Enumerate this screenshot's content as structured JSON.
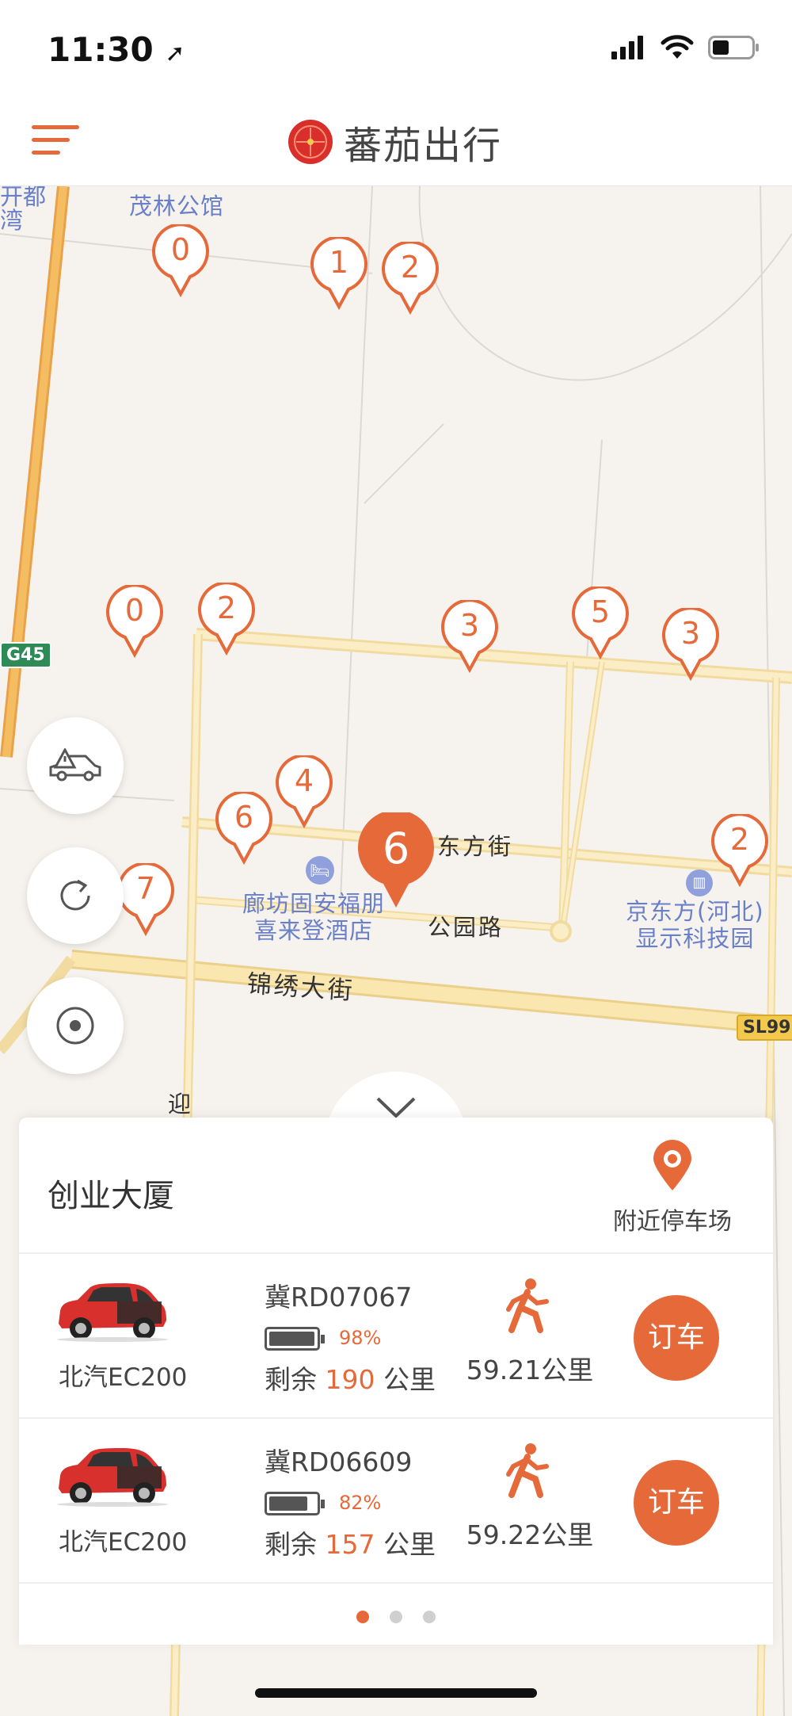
{
  "status_bar": {
    "time": "11:30"
  },
  "header": {
    "title": "蕃茄出行"
  },
  "map": {
    "labels": {
      "top_poi": "茂林公馆",
      "left_edge_top": "开都",
      "left_edge_bottom": "湾",
      "dongfang_street": "东方街",
      "park_road": "公园路",
      "jinxiu_street": "锦绣大街",
      "ying": "迎",
      "hotel_line1": "廊坊固安福朋",
      "hotel_line2": "喜来登酒店",
      "boe_line1": "京东方(河北)",
      "boe_line2": "显示科技园"
    },
    "shields": {
      "g45": "G45",
      "sl99": "SL99"
    },
    "pins": [
      {
        "count": "0"
      },
      {
        "count": "1"
      },
      {
        "count": "2"
      },
      {
        "count": "0"
      },
      {
        "count": "2"
      },
      {
        "count": "3"
      },
      {
        "count": "5"
      },
      {
        "count": "3"
      },
      {
        "count": "4"
      },
      {
        "count": "6"
      },
      {
        "count": "7"
      },
      {
        "count": "2"
      }
    ],
    "selected_pin": {
      "count": "6"
    }
  },
  "controls": {
    "icons": [
      "car-warning-icon",
      "refresh-icon",
      "locate-icon"
    ]
  },
  "sheet": {
    "station_name": "创业大厦",
    "nearby_parking_label": "附近停车场",
    "cars": [
      {
        "model": "北汽EC200",
        "plate": "冀RD07067",
        "battery_percent": "98%",
        "battery_level": 0.98,
        "range_prefix": "剩余",
        "range_value": "190",
        "range_unit": "公里",
        "distance": "59.21公里",
        "book_label": "订车"
      },
      {
        "model": "北汽EC200",
        "plate": "冀RD06609",
        "battery_percent": "82%",
        "battery_level": 0.82,
        "range_prefix": "剩余",
        "range_value": "157",
        "range_unit": "公里",
        "distance": "59.22公里",
        "book_label": "订车"
      }
    ],
    "pagination": {
      "total": 3,
      "active": 1
    }
  },
  "colors": {
    "accent": "#e6693a",
    "map_bg": "#f6f3ee",
    "road": "#f7d98b",
    "poi": "#6a7fc9"
  }
}
